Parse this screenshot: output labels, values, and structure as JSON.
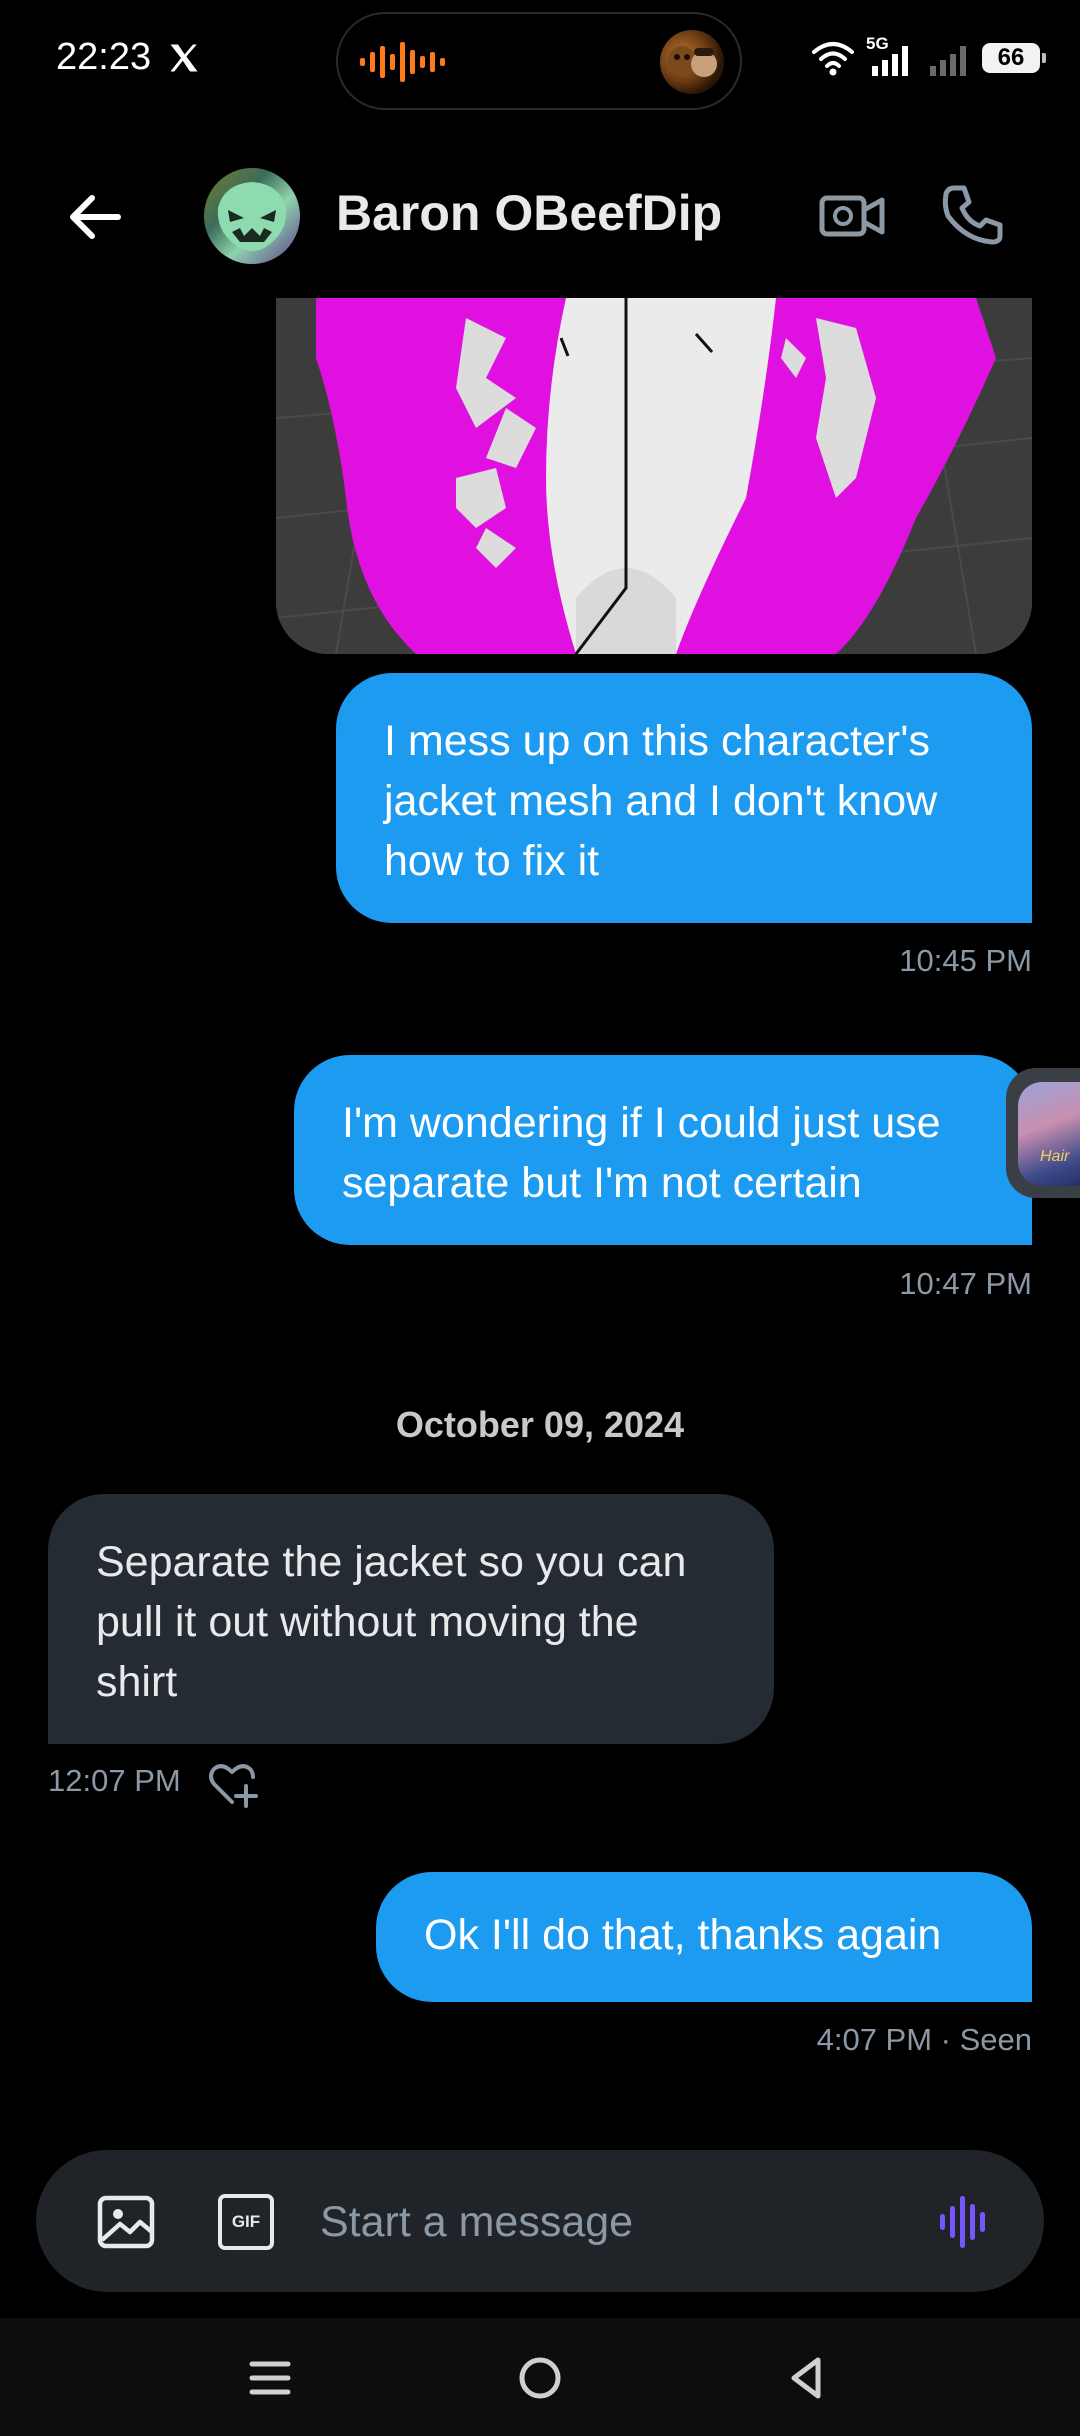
{
  "status_bar": {
    "time": "22:23",
    "network": "5G",
    "battery": "66"
  },
  "header": {
    "contact_name": "Baron OBeefDip",
    "icons": {
      "back": "arrow-left-icon",
      "video": "video-call-icon",
      "call": "phone-icon"
    }
  },
  "conversation": {
    "messages": [
      {
        "direction": "sent",
        "text": "I mess up on this character's jacket mesh and I don't know how to fix it",
        "time": "10:45 PM"
      },
      {
        "direction": "sent",
        "text": "I'm wondering if I could just use separate but I'm not certain",
        "time": "10:47 PM"
      },
      {
        "direction": "received",
        "text": "Separate the jacket so you can pull it out without moving the shirt",
        "time": "12:07 PM"
      },
      {
        "direction": "sent",
        "text": "Ok I'll do that, thanks again",
        "time": "4:07 PM · Seen"
      }
    ],
    "date_separator": "October 09, 2024",
    "edge_bubble_text": "Hair"
  },
  "composer": {
    "placeholder": "Start a message",
    "gif_label": "GIF"
  },
  "colors": {
    "sent_bubble": "#1d9bf0",
    "received_bubble": "#252b32",
    "background": "#000000",
    "timestamp": "#8b98a5",
    "voice_accent": "#7856ff",
    "wave_accent": "#ff7a1a"
  }
}
